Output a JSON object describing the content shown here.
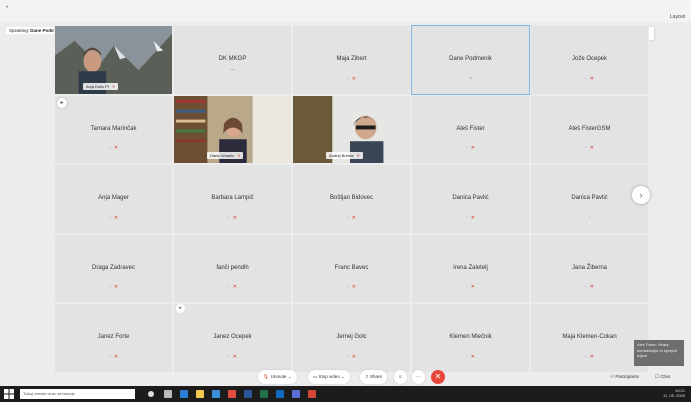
{
  "topbar": {
    "dot": "•",
    "layout_label": "Layout"
  },
  "speaking": {
    "prefix": "Speaking:",
    "name": "Dane Podmenik"
  },
  "shared_content": {
    "close": "‹",
    "label": "Show shared content view"
  },
  "tiles": [
    {
      "name": "Anja Dolic Pf",
      "video": true,
      "scene": "mountain"
    },
    {
      "name": "DK MKGP",
      "sub": "—"
    },
    {
      "name": "Maja Zibert"
    },
    {
      "name": "Dane Podmenik",
      "active": true
    },
    {
      "name": "Jože Ocepek"
    },
    {
      "name": "Tamara Marinčak"
    },
    {
      "name": "Daria Vrbanic",
      "video": true,
      "scene": "bookshelf"
    },
    {
      "name": "Andrej Brenta",
      "video": true,
      "scene": "window"
    },
    {
      "name": "Aleš Fister"
    },
    {
      "name": "Aleš FisterGSM"
    },
    {
      "name": "Anja Mager"
    },
    {
      "name": "Barbara Lampič"
    },
    {
      "name": "Boštjan Bidovec"
    },
    {
      "name": "Danica Pavlić"
    },
    {
      "name": "Danica Pavlić"
    },
    {
      "name": "Draga Zadravec"
    },
    {
      "name": "fanči pendih"
    },
    {
      "name": "Franc Bavec"
    },
    {
      "name": "Irena Zaletelj"
    },
    {
      "name": "Jana Žiberna"
    },
    {
      "name": "Janez Forte"
    },
    {
      "name": "Janez Ocepek"
    },
    {
      "name": "Jernej Golc"
    },
    {
      "name": "Klemen Mlečnik"
    },
    {
      "name": "Maja Klemen-Cokan"
    }
  ],
  "controls": {
    "unmute": "Unmute",
    "video": "Stop video",
    "share": "Share",
    "participants": "Participants",
    "chat": "Chat"
  },
  "tooltip": "Aleš Fister: Hvala, kontaktirajte in sprejmi izjave",
  "taskbar": {
    "search_placeholder": "Tukaj vnesite izraz za iskanje",
    "time": "10:21",
    "date": "11. 05. 2020"
  },
  "colors": {
    "mute_red": "#d23a2a",
    "end_red": "#e8463a",
    "active_border": "#7fb6e8"
  }
}
